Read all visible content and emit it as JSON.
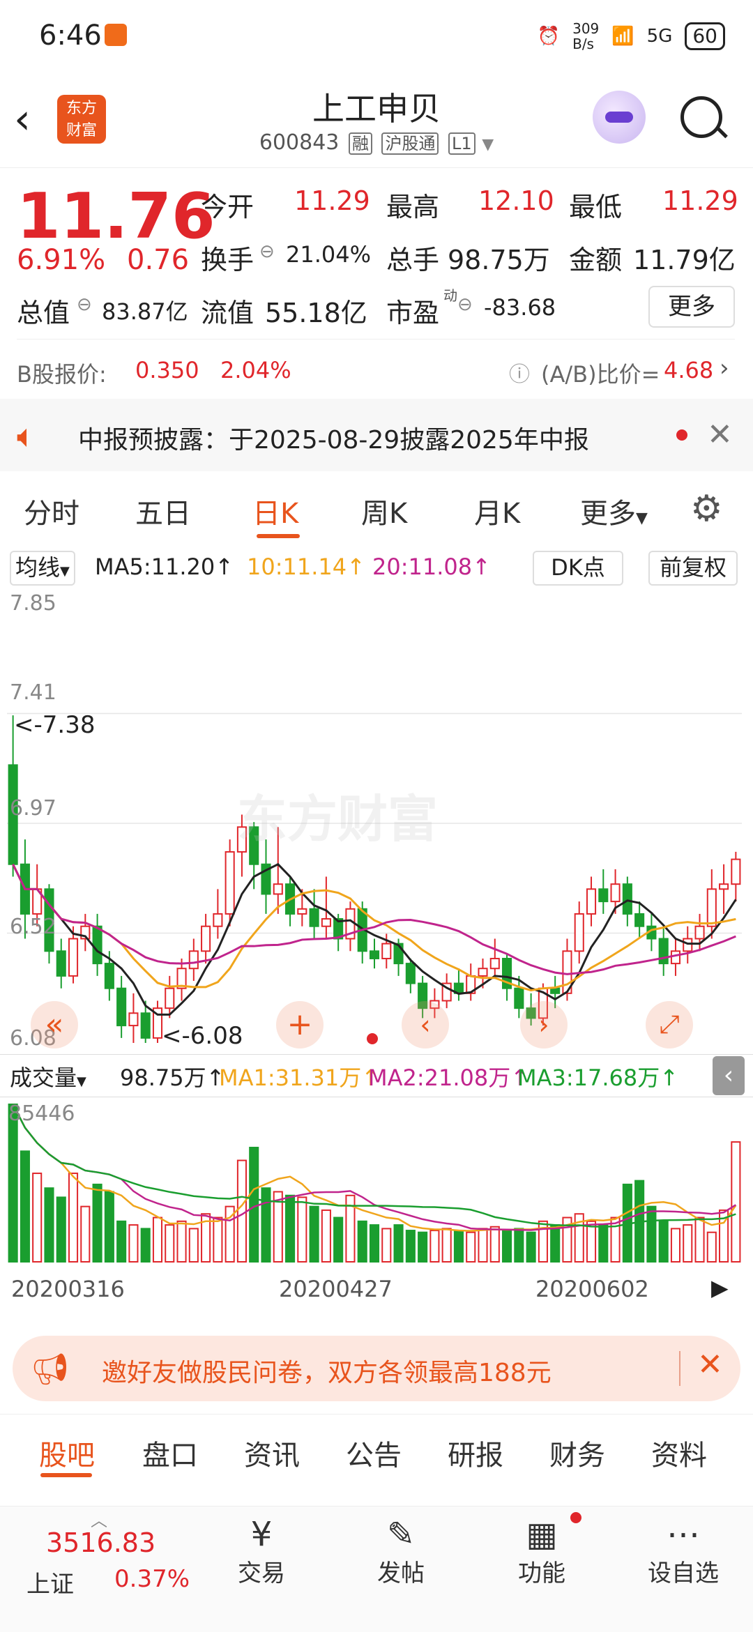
{
  "status": {
    "time": "6:46",
    "net_speed": "309\nB/s",
    "signal": "5G",
    "battery": "60"
  },
  "header": {
    "title": "上工申贝",
    "code": "600843",
    "tags": [
      "融",
      "沪股通",
      "L1"
    ]
  },
  "quote": {
    "price": "11.76",
    "change_pct": "6.91%",
    "change": "0.76",
    "open_label": "今开",
    "open": "11.29",
    "high_label": "最高",
    "high": "12.10",
    "low_label": "最低",
    "low": "11.29",
    "turnover_label": "换手",
    "turnover": "21.04%",
    "volume_label": "总手",
    "volume": "98.75万",
    "amount_label": "金额",
    "amount": "11.79亿",
    "mcap_label": "总值",
    "mcap": "83.87亿",
    "float_label": "流值",
    "float": "55.18亿",
    "pe_label": "市盈",
    "pe_sup": "动",
    "pe": "-83.68",
    "more": "更多",
    "bshare_label": "B股报价:",
    "bshare_price": "0.350",
    "bshare_pct": "2.04%",
    "ab_label": "(A/B)比价=",
    "ab_value": "4.68"
  },
  "notice": {
    "text": "中报预披露：于2025-08-29披露2025年中报"
  },
  "tabs": [
    "分时",
    "五日",
    "日K",
    "周K",
    "月K",
    "更多"
  ],
  "active_tab": 2,
  "kline": {
    "ma_select": "均线",
    "ma5": "MA5:11.20↑",
    "ma10": "10:11.14↑",
    "ma20": "20:11.08↑",
    "dk": "DK点",
    "adj": "前复权",
    "y_labels": [
      "7.85",
      "7.41",
      "6.97",
      "6.52",
      "6.08"
    ],
    "max_marker": "<-7.38",
    "min_marker": "<-6.08",
    "watermark": "东方财富"
  },
  "volume": {
    "select": "成交量",
    "vol": "98.75万↑",
    "ma1": "MA1:31.31万↑",
    "ma2": "MA2:21.08万↑",
    "ma3": "MA3:17.68万↑",
    "top": "85446",
    "dates": [
      "20200316",
      "20200427",
      "20200602"
    ]
  },
  "banner": {
    "text": "邀好友做股民问卷，双方各领最高188元"
  },
  "bottom_tabs": [
    "股吧",
    "盘口",
    "资讯",
    "公告",
    "研报",
    "财务",
    "资料"
  ],
  "index": {
    "value": "3516.83",
    "name": "上证",
    "pct": "0.37%"
  },
  "nav": [
    "交易",
    "发帖",
    "功能",
    "设自选"
  ],
  "chart_data": {
    "type": "candlestick",
    "ylim": [
      6.08,
      7.85
    ],
    "candles": [
      {
        "o": 7.2,
        "c": 6.8,
        "h": 7.4,
        "l": 6.75
      },
      {
        "o": 6.8,
        "c": 6.6,
        "h": 6.9,
        "l": 6.5
      },
      {
        "o": 6.6,
        "c": 6.7,
        "h": 6.8,
        "l": 6.55
      },
      {
        "o": 6.7,
        "c": 6.45,
        "h": 6.72,
        "l": 6.4
      },
      {
        "o": 6.45,
        "c": 6.35,
        "h": 6.5,
        "l": 6.3
      },
      {
        "o": 6.35,
        "c": 6.5,
        "h": 6.55,
        "l": 6.32
      },
      {
        "o": 6.5,
        "c": 6.55,
        "h": 6.6,
        "l": 6.45
      },
      {
        "o": 6.55,
        "c": 6.4,
        "h": 6.6,
        "l": 6.35
      },
      {
        "o": 6.4,
        "c": 6.3,
        "h": 6.45,
        "l": 6.25
      },
      {
        "o": 6.3,
        "c": 6.15,
        "h": 6.35,
        "l": 6.1
      },
      {
        "o": 6.15,
        "c": 6.2,
        "h": 6.28,
        "l": 6.08
      },
      {
        "o": 6.2,
        "c": 6.1,
        "h": 6.25,
        "l": 6.08
      },
      {
        "o": 6.1,
        "c": 6.22,
        "h": 6.25,
        "l": 6.08
      },
      {
        "o": 6.22,
        "c": 6.3,
        "h": 6.35,
        "l": 6.18
      },
      {
        "o": 6.3,
        "c": 6.38,
        "h": 6.42,
        "l": 6.25
      },
      {
        "o": 6.38,
        "c": 6.45,
        "h": 6.5,
        "l": 6.33
      },
      {
        "o": 6.45,
        "c": 6.55,
        "h": 6.6,
        "l": 6.4
      },
      {
        "o": 6.55,
        "c": 6.6,
        "h": 6.7,
        "l": 6.5
      },
      {
        "o": 6.6,
        "c": 6.85,
        "h": 6.9,
        "l": 6.55
      },
      {
        "o": 6.85,
        "c": 6.95,
        "h": 7.0,
        "l": 6.75
      },
      {
        "o": 6.95,
        "c": 6.8,
        "h": 6.97,
        "l": 6.7
      },
      {
        "o": 6.8,
        "c": 6.68,
        "h": 6.9,
        "l": 6.6
      },
      {
        "o": 6.68,
        "c": 6.72,
        "h": 6.95,
        "l": 6.6
      },
      {
        "o": 6.72,
        "c": 6.6,
        "h": 6.75,
        "l": 6.55
      },
      {
        "o": 6.6,
        "c": 6.62,
        "h": 6.7,
        "l": 6.55
      },
      {
        "o": 6.62,
        "c": 6.55,
        "h": 6.7,
        "l": 6.5
      },
      {
        "o": 6.55,
        "c": 6.58,
        "h": 6.75,
        "l": 6.5
      },
      {
        "o": 6.58,
        "c": 6.5,
        "h": 6.6,
        "l": 6.45
      },
      {
        "o": 6.5,
        "c": 6.62,
        "h": 6.65,
        "l": 6.45
      },
      {
        "o": 6.62,
        "c": 6.45,
        "h": 6.65,
        "l": 6.4
      },
      {
        "o": 6.45,
        "c": 6.42,
        "h": 6.5,
        "l": 6.38
      },
      {
        "o": 6.42,
        "c": 6.48,
        "h": 6.52,
        "l": 6.38
      },
      {
        "o": 6.48,
        "c": 6.4,
        "h": 6.5,
        "l": 6.35
      },
      {
        "o": 6.4,
        "c": 6.32,
        "h": 6.42,
        "l": 6.28
      },
      {
        "o": 6.32,
        "c": 6.22,
        "h": 6.35,
        "l": 6.18
      },
      {
        "o": 6.22,
        "c": 6.25,
        "h": 6.3,
        "l": 6.18
      },
      {
        "o": 6.25,
        "c": 6.32,
        "h": 6.36,
        "l": 6.22
      },
      {
        "o": 6.32,
        "c": 6.28,
        "h": 6.38,
        "l": 6.25
      },
      {
        "o": 6.28,
        "c": 6.35,
        "h": 6.4,
        "l": 6.25
      },
      {
        "o": 6.35,
        "c": 6.38,
        "h": 6.42,
        "l": 6.3
      },
      {
        "o": 6.38,
        "c": 6.42,
        "h": 6.5,
        "l": 6.35
      },
      {
        "o": 6.42,
        "c": 6.3,
        "h": 6.44,
        "l": 6.25
      },
      {
        "o": 6.3,
        "c": 6.22,
        "h": 6.35,
        "l": 6.18
      },
      {
        "o": 6.22,
        "c": 6.18,
        "h": 6.28,
        "l": 6.15
      },
      {
        "o": 6.18,
        "c": 6.3,
        "h": 6.32,
        "l": 6.15
      },
      {
        "o": 6.3,
        "c": 6.28,
        "h": 6.35,
        "l": 6.22
      },
      {
        "o": 6.28,
        "c": 6.45,
        "h": 6.5,
        "l": 6.25
      },
      {
        "o": 6.45,
        "c": 6.6,
        "h": 6.65,
        "l": 6.4
      },
      {
        "o": 6.6,
        "c": 6.7,
        "h": 6.75,
        "l": 6.55
      },
      {
        "o": 6.7,
        "c": 6.65,
        "h": 6.78,
        "l": 6.6
      },
      {
        "o": 6.65,
        "c": 6.72,
        "h": 6.78,
        "l": 6.6
      },
      {
        "o": 6.72,
        "c": 6.6,
        "h": 6.75,
        "l": 6.55
      },
      {
        "o": 6.6,
        "c": 6.55,
        "h": 6.65,
        "l": 6.5
      },
      {
        "o": 6.55,
        "c": 6.5,
        "h": 6.6,
        "l": 6.45
      },
      {
        "o": 6.5,
        "c": 6.4,
        "h": 6.55,
        "l": 6.35
      },
      {
        "o": 6.4,
        "c": 6.45,
        "h": 6.5,
        "l": 6.35
      },
      {
        "o": 6.45,
        "c": 6.5,
        "h": 6.55,
        "l": 6.4
      },
      {
        "o": 6.5,
        "c": 6.55,
        "h": 6.6,
        "l": 6.45
      },
      {
        "o": 6.55,
        "c": 6.7,
        "h": 6.78,
        "l": 6.5
      },
      {
        "o": 6.7,
        "c": 6.72,
        "h": 6.8,
        "l": 6.6
      },
      {
        "o": 6.72,
        "c": 6.82,
        "h": 6.85,
        "l": 6.65
      }
    ],
    "volumes": [
      85446,
      60000,
      48000,
      40000,
      35000,
      48000,
      30000,
      42000,
      38000,
      22000,
      20000,
      18000,
      24000,
      20000,
      22000,
      18000,
      26000,
      24000,
      30000,
      55000,
      62000,
      40000,
      38000,
      36000,
      35000,
      30000,
      28000,
      24000,
      36000,
      22000,
      20000,
      18000,
      20000,
      17000,
      16000,
      17000,
      18000,
      17000,
      16000,
      18000,
      19000,
      17000,
      18000,
      16000,
      22000,
      20000,
      24000,
      26000,
      22000,
      20000,
      24000,
      42000,
      44000,
      30000,
      22000,
      18000,
      20000,
      24000,
      16000,
      28000,
      65000
    ]
  }
}
